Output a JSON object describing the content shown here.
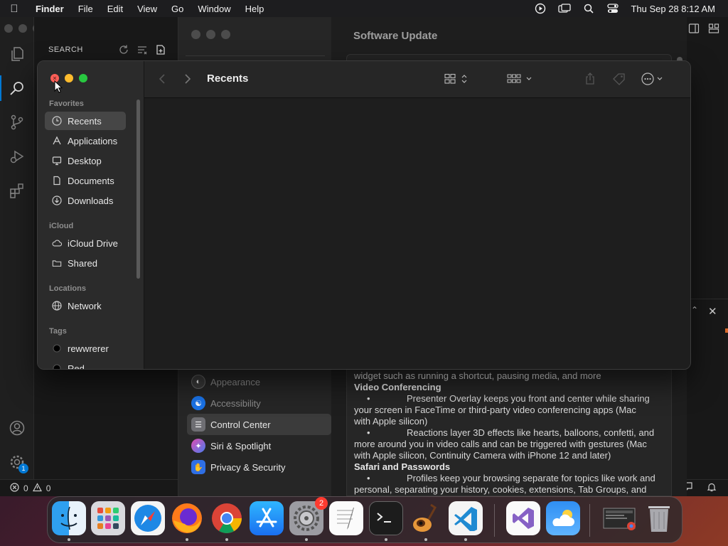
{
  "menubar": {
    "app_name": "Finder",
    "items": [
      "File",
      "Edit",
      "View",
      "Go",
      "Window",
      "Help"
    ],
    "datetime": "Thu Sep 28  8:12 AM"
  },
  "vscode": {
    "search_header": "SEARCH",
    "status": {
      "errors": "0",
      "warnings": "0"
    },
    "manage_badge": "1"
  },
  "settings": {
    "title": "Software Update",
    "sidebar": [
      {
        "label": "Appearance",
        "color": "#3a3a3a",
        "icon": "appearance-icon"
      },
      {
        "label": "Accessibility",
        "color": "#1a73e8",
        "icon": "accessibility-icon"
      },
      {
        "label": "Control Center",
        "color": "#6e6e73",
        "icon": "control-center-icon"
      },
      {
        "label": "Siri & Spotlight",
        "color": "#b04ad8",
        "icon": "siri-icon"
      },
      {
        "label": "Privacy & Security",
        "color": "#2f6fe4",
        "icon": "hand-icon"
      }
    ],
    "notes": {
      "line1": "widget such as running a shortcut, pausing media, and more",
      "heading1": "Video Conferencing",
      "b1_l1": "Presenter Overlay keeps you front and center while sharing",
      "b1_l2": "your screen in FaceTime or third-party video conferencing apps (Mac",
      "b1_l3": "with Apple silicon)",
      "b2_l1": "Reactions layer 3D effects like hearts, balloons, confetti, and",
      "b2_l2": "more around you in video calls and can be triggered with gestures (Mac",
      "b2_l3": "with Apple silicon, Continuity Camera with iPhone 12 and later)",
      "heading2": "Safari and Passwords",
      "b3_l1": "Profiles keep your browsing separate for topics like work and",
      "b3_l2": "personal, separating your history, cookies, extensions, Tab Groups, and"
    }
  },
  "finder": {
    "title": "Recents",
    "sections": {
      "favorites": "Favorites",
      "icloud": "iCloud",
      "locations": "Locations",
      "tags": "Tags"
    },
    "favorites": [
      {
        "label": "Recents",
        "icon": "clock-icon"
      },
      {
        "label": "Applications",
        "icon": "applications-icon"
      },
      {
        "label": "Desktop",
        "icon": "desktop-icon"
      },
      {
        "label": "Documents",
        "icon": "document-icon"
      },
      {
        "label": "Downloads",
        "icon": "download-icon"
      }
    ],
    "icloud": [
      {
        "label": "iCloud Drive",
        "icon": "cloud-icon"
      },
      {
        "label": "Shared",
        "icon": "shared-folder-icon"
      }
    ],
    "locations": [
      {
        "label": "Network",
        "icon": "globe-icon"
      }
    ],
    "tags": [
      {
        "label": "rewwrerer",
        "color": "#000000"
      },
      {
        "label": "Red",
        "color": "#000000"
      }
    ]
  },
  "dock": {
    "apps": [
      "Finder",
      "Launchpad",
      "Safari",
      "Firefox",
      "Chrome",
      "App Store",
      "System Settings",
      "TextEdit",
      "Terminal",
      "GarageBand",
      "Visual Studio Code",
      "Visual Studio",
      "Weather",
      "Screenshot",
      "Trash"
    ],
    "settings_badge": "2"
  }
}
